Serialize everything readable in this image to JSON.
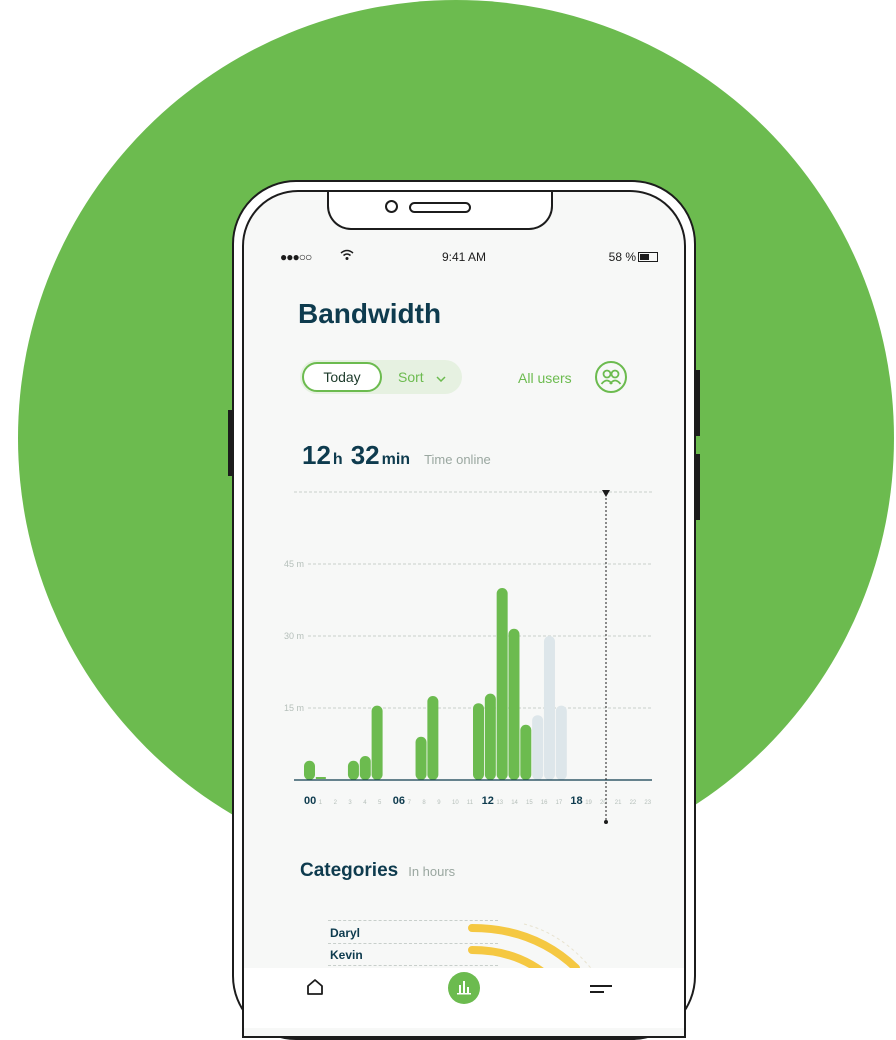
{
  "status_bar": {
    "signal": "●●●○○",
    "time": "9:41 AM",
    "battery": "58 %"
  },
  "header": {
    "title": "Bandwidth"
  },
  "filters": {
    "today_label": "Today",
    "sort_label": "Sort",
    "all_users_label": "All users"
  },
  "summary": {
    "hours": "12",
    "hours_unit": "h",
    "minutes": "32",
    "minutes_unit": "min",
    "label": "Time online"
  },
  "chart_data": {
    "type": "bar",
    "y_ticks": [
      "45 m",
      "30 m",
      "15 m"
    ],
    "ylim": [
      0,
      60
    ],
    "x_ticks": [
      "00",
      "1",
      "2",
      "3",
      "4",
      "5",
      "06",
      "7",
      "8",
      "9",
      "10",
      "11",
      "12",
      "13",
      "14",
      "15",
      "16",
      "17",
      "18",
      "19",
      "20",
      "21",
      "22",
      "23"
    ],
    "bold_ticks": [
      "00",
      "06",
      "12",
      "18"
    ],
    "bars": [
      {
        "x": 0.0,
        "value": 4,
        "state": "past"
      },
      {
        "x": 0.7,
        "value": 0.5,
        "state": "past"
      },
      {
        "x": 2.6,
        "value": 4,
        "state": "past"
      },
      {
        "x": 3.3,
        "value": 5,
        "state": "past"
      },
      {
        "x": 4.0,
        "value": 15.5,
        "state": "past"
      },
      {
        "x": 6.6,
        "value": 9,
        "state": "past"
      },
      {
        "x": 7.3,
        "value": 17.5,
        "state": "past"
      },
      {
        "x": 10.0,
        "value": 16,
        "state": "past"
      },
      {
        "x": 10.7,
        "value": 18,
        "state": "past"
      },
      {
        "x": 11.4,
        "value": 40,
        "state": "past"
      },
      {
        "x": 12.1,
        "value": 31.5,
        "state": "past"
      },
      {
        "x": 12.8,
        "value": 11.5,
        "state": "past"
      },
      {
        "x": 13.5,
        "value": 13.5,
        "state": "future"
      },
      {
        "x": 14.2,
        "value": 30,
        "state": "future"
      },
      {
        "x": 14.9,
        "value": 15.5,
        "state": "future"
      }
    ],
    "current_hour": 20,
    "colors": {
      "past": "#6cbb4f",
      "future": "#dde6ea",
      "axis": "#0e3b4e"
    }
  },
  "categories": {
    "title": "Categories",
    "subtitle": "In hours",
    "items": [
      {
        "name": "Daryl"
      },
      {
        "name": "Kevin"
      }
    ],
    "arc_color": "#f5c842"
  },
  "colors": {
    "brand": "#6cbb4f",
    "heading": "#0e3b4e"
  }
}
